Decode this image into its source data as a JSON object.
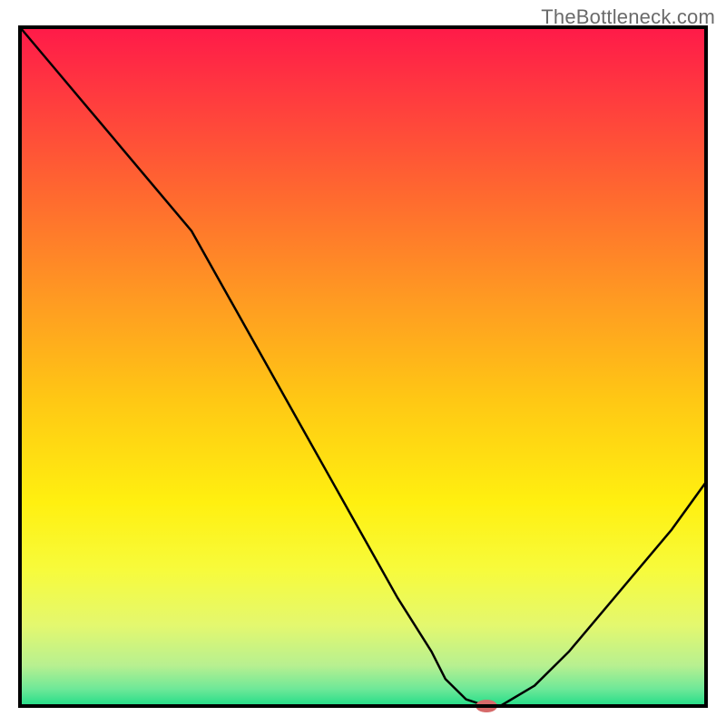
{
  "watermark": "TheBottleneck.com",
  "chart_data": {
    "type": "line",
    "title": "",
    "xlabel": "",
    "ylabel": "",
    "xlim": [
      0,
      100
    ],
    "ylim": [
      0,
      100
    ],
    "grid": false,
    "legend": false,
    "series": [
      {
        "name": "bottleneck-curve",
        "x": [
          0,
          5,
          10,
          15,
          20,
          25,
          30,
          35,
          40,
          45,
          50,
          55,
          60,
          62,
          65,
          68,
          70,
          75,
          80,
          85,
          90,
          95,
          100
        ],
        "values": [
          100,
          94,
          88,
          82,
          76,
          70,
          61,
          52,
          43,
          34,
          25,
          16,
          8,
          4,
          1,
          0,
          0,
          3,
          8,
          14,
          20,
          26,
          33
        ]
      }
    ],
    "marker": {
      "x": 68,
      "y": 0,
      "color": "#d66a6a",
      "rx": 12,
      "ry": 7
    },
    "gradient_stops": [
      {
        "offset": 0.0,
        "color": "#ff1a49"
      },
      {
        "offset": 0.1,
        "color": "#ff3a3f"
      },
      {
        "offset": 0.25,
        "color": "#ff6a2f"
      },
      {
        "offset": 0.4,
        "color": "#ff9a22"
      },
      {
        "offset": 0.55,
        "color": "#ffc814"
      },
      {
        "offset": 0.7,
        "color": "#fff010"
      },
      {
        "offset": 0.8,
        "color": "#f7fb3c"
      },
      {
        "offset": 0.88,
        "color": "#e4f86e"
      },
      {
        "offset": 0.94,
        "color": "#b8f090"
      },
      {
        "offset": 0.975,
        "color": "#6ee898"
      },
      {
        "offset": 1.0,
        "color": "#22dd88"
      }
    ],
    "frame": {
      "stroke": "#000000",
      "stroke_width": 4
    },
    "curve_style": {
      "stroke": "#000000",
      "stroke_width": 2.5
    }
  }
}
